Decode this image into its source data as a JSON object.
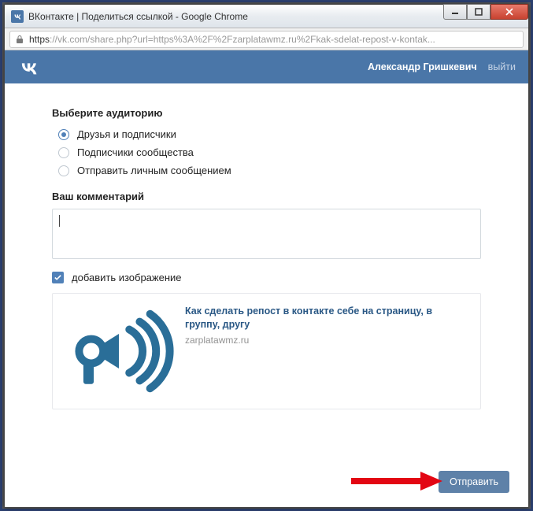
{
  "window": {
    "title": "ВКонтакте | Поделиться ссылкой - Google Chrome",
    "url_prefix": "https",
    "url_rest": "://vk.com/share.php?url=https%3A%2F%2Fzarplatawmz.ru%2Fkak-sdelat-repost-v-kontak..."
  },
  "vk": {
    "user": "Александр Гришкевич",
    "logout": "выйти"
  },
  "form": {
    "audience_title": "Выберите аудиторию",
    "radios": [
      {
        "label": "Друзья и подписчики",
        "checked": true
      },
      {
        "label": "Подписчики сообщества",
        "checked": false
      },
      {
        "label": "Отправить личным сообщением",
        "checked": false
      }
    ],
    "comment_title": "Ваш комментарий",
    "comment_value": "",
    "add_image_label": "добавить изображение",
    "add_image_checked": true,
    "preview": {
      "title": "Как сделать репост в контакте себе на страницу, в группу, другу",
      "domain": "zarplatawmz.ru"
    },
    "submit": "Отправить"
  }
}
